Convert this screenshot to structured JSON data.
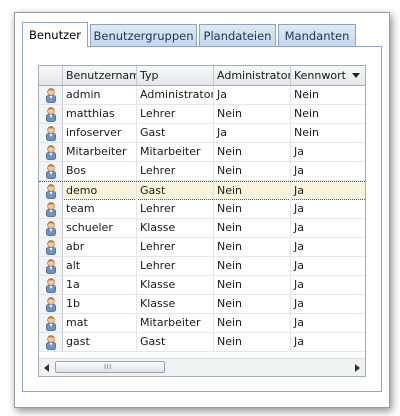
{
  "tabs": [
    {
      "label": "Benutzer",
      "active": true
    },
    {
      "label": "Benutzergruppen",
      "active": false
    },
    {
      "label": "Plandateien",
      "active": false
    },
    {
      "label": "Mandanten",
      "active": false
    }
  ],
  "grid": {
    "columns": [
      "Benutzername",
      "Typ",
      "Administrator",
      "Kennwort"
    ],
    "sorted_column": "Kennwort",
    "sort_direction": "descending",
    "row_icon": "user-icon",
    "selected_row": "demo",
    "rows": [
      [
        "admin",
        "Administrator",
        "Ja",
        "Nein"
      ],
      [
        "matthias",
        "Lehrer",
        "Nein",
        "Nein"
      ],
      [
        "infoserver",
        "Gast",
        "Ja",
        "Nein"
      ],
      [
        "Mitarbeiter",
        "Mitarbeiter",
        "Nein",
        "Ja"
      ],
      [
        "Bos",
        "Lehrer",
        "Nein",
        "Ja"
      ],
      [
        "demo",
        "Gast",
        "Nein",
        "Ja"
      ],
      [
        "team",
        "Lehrer",
        "Nein",
        "Ja"
      ],
      [
        "schueler",
        "Klasse",
        "Nein",
        "Ja"
      ],
      [
        "abr",
        "Lehrer",
        "Nein",
        "Ja"
      ],
      [
        "alt",
        "Lehrer",
        "Nein",
        "Ja"
      ],
      [
        "1a",
        "Klasse",
        "Nein",
        "Ja"
      ],
      [
        "1b",
        "Klasse",
        "Nein",
        "Ja"
      ],
      [
        "mat",
        "Mitarbeiter",
        "Nein",
        "Ja"
      ],
      [
        "gast",
        "Gast",
        "Nein",
        "Ja"
      ]
    ]
  },
  "scrollbar": {
    "grip": "III"
  },
  "colors": {
    "tab_border": "#8ba5c7",
    "tab_inactive_bg": "#c5d7ee",
    "selected_row_bg": "#fbf4dd",
    "grid_border": "#a5acb5"
  }
}
